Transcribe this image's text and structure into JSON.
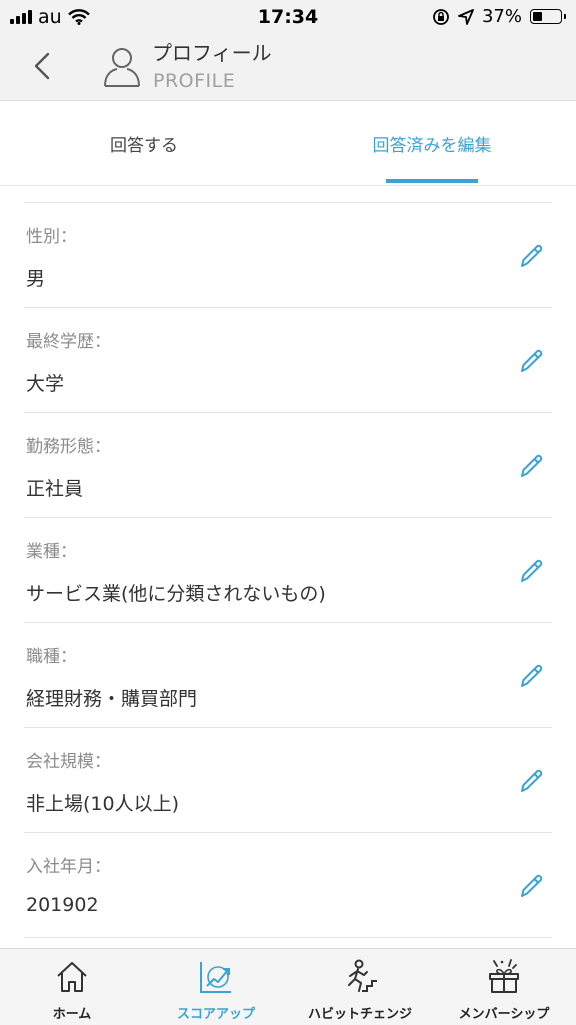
{
  "status_bar": {
    "carrier": "au",
    "time": "17:34",
    "battery_percent": "37%",
    "battery_level": 0.37
  },
  "header": {
    "title": "プロフィール",
    "subtitle": "PROFILE"
  },
  "tabs": [
    {
      "label": "回答する",
      "active": false
    },
    {
      "label": "回答済みを編集",
      "active": true
    }
  ],
  "fields": [
    {
      "label": "性別：",
      "value": "男"
    },
    {
      "label": "最終学歴：",
      "value": "大学"
    },
    {
      "label": "勤務形態：",
      "value": "正社員"
    },
    {
      "label": "業種：",
      "value": "サービス業(他に分類されないもの)"
    },
    {
      "label": "職種：",
      "value": "経理財務・購買部門"
    },
    {
      "label": "会社規模：",
      "value": "非上場(10人以上)"
    },
    {
      "label": "入社年月：",
      "value": "201902"
    }
  ],
  "tab_bar": [
    {
      "label": "ホーム",
      "icon": "home-icon"
    },
    {
      "label": "スコアアップ",
      "icon": "score-chart-icon",
      "active": true
    },
    {
      "label": "ハビットチェンジ",
      "icon": "habit-runner-icon"
    },
    {
      "label": "メンバーシップ",
      "icon": "membership-gift-icon"
    }
  ],
  "colors": {
    "accent": "#3aa3d4",
    "header_bg": "#f2f2f2"
  }
}
